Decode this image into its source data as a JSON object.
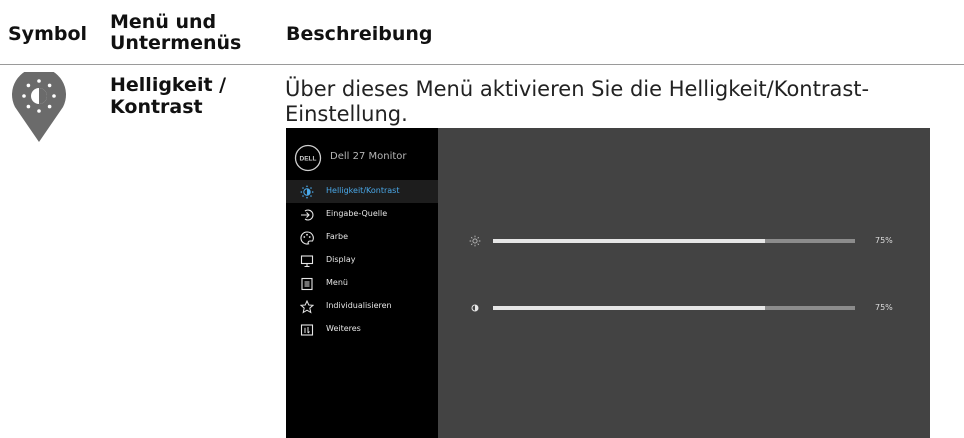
{
  "header": {
    "col_symbol": "Symbol",
    "col_menu_line1": "Menü und",
    "col_menu_line2": "Untermenüs",
    "col_description": "Beschreibung"
  },
  "row": {
    "icon": "brightness-pin-icon",
    "name_line1": "Helligkeit /",
    "name_line2": "Kontrast",
    "description": "Über dieses Menü aktivieren Sie die Helligkeit/Kontrast-Einstellung."
  },
  "osd": {
    "logo_text": "DELL",
    "title": "Dell 27 Monitor",
    "menu": [
      {
        "label": "Helligkeit/Kontrast",
        "icon": "brightness-icon",
        "active": true
      },
      {
        "label": "Eingabe-Quelle",
        "icon": "input-source-icon",
        "active": false
      },
      {
        "label": "Farbe",
        "icon": "color-icon",
        "active": false
      },
      {
        "label": "Display",
        "icon": "display-icon",
        "active": false
      },
      {
        "label": "Menü",
        "icon": "menu-icon",
        "active": false
      },
      {
        "label": "Individualisieren",
        "icon": "star-icon",
        "active": false
      },
      {
        "label": "Weiteres",
        "icon": "info-icon",
        "active": false
      }
    ],
    "sliders": [
      {
        "name": "brightness",
        "icon": "sun-icon",
        "value": 75,
        "label": "75%"
      },
      {
        "name": "contrast",
        "icon": "contrast-icon",
        "value": 75,
        "label": "75%"
      }
    ],
    "colors": {
      "accent": "#4aa8e8",
      "panel": "#434343",
      "sidebar": "#000000",
      "track": "#8c8c8c",
      "fill": "#e6e6e6"
    }
  }
}
